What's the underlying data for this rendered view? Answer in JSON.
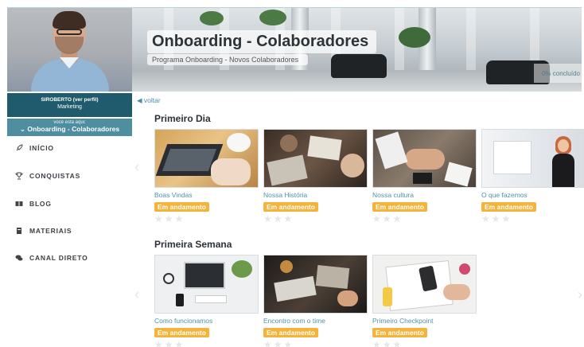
{
  "header": {
    "title": "Onboarding - Colaboradores",
    "subtitle": "Programa Onboarding - Novos Colaboradores",
    "progress_label": "0% concluído"
  },
  "user": {
    "name": "SIROBERTO (ver perfil)",
    "role": "Marketing"
  },
  "location": {
    "label": "você está aqui:",
    "current": "Onboarding - Colaboradores",
    "chevron_icon": "chevron-down-icon"
  },
  "menu": [
    {
      "label": "INÍCIO",
      "icon": "rocket-icon"
    },
    {
      "label": "CONQUISTAS",
      "icon": "trophy-icon"
    },
    {
      "label": "BLOG",
      "icon": "book-icon"
    },
    {
      "label": "MATERIAIS",
      "icon": "notebook-icon"
    },
    {
      "label": "CANAL DIRETO",
      "icon": "chat-icon"
    }
  ],
  "back_label": "◀ voltar",
  "sections": [
    {
      "title": "Primeiro Dia",
      "cards": [
        {
          "title": "Boas Vindas",
          "status": "Em andamento",
          "rating": 0,
          "stars_max": 3
        },
        {
          "title": "Nossa História",
          "status": "Em andamento",
          "rating": 0,
          "stars_max": 3
        },
        {
          "title": "Nossa cultura",
          "status": "Em andamento",
          "rating": 0,
          "stars_max": 3
        },
        {
          "title": "O que fazemos",
          "status": "Em andamento",
          "rating": 0,
          "stars_max": 3
        }
      ]
    },
    {
      "title": "Primeira Semana",
      "cards": [
        {
          "title": "Como funcionamos",
          "status": "Em andamento",
          "rating": 0,
          "stars_max": 3
        },
        {
          "title": "Encontro com o time",
          "status": "Em andamento",
          "rating": 0,
          "stars_max": 3
        },
        {
          "title": "Primeiro Checkpoint",
          "status": "Em andamento",
          "rating": 0,
          "stars_max": 3
        }
      ]
    }
  ],
  "colors": {
    "primary": "#1f5b6c",
    "secondary": "#4e8ea0",
    "link": "#4f94a8",
    "badge": "#f4b33b"
  }
}
